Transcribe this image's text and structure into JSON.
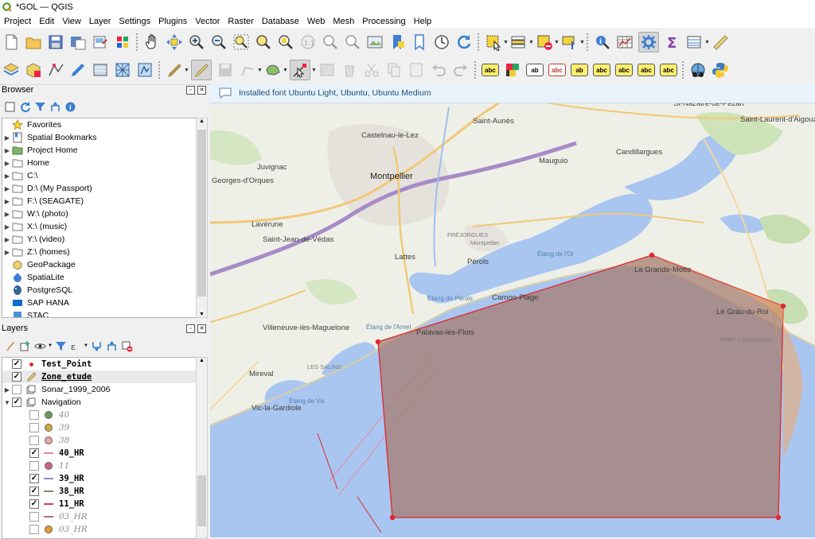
{
  "window": {
    "title": "*GOL — QGIS"
  },
  "menu": [
    "Project",
    "Edit",
    "View",
    "Layer",
    "Settings",
    "Plugins",
    "Vector",
    "Raster",
    "Database",
    "Web",
    "Mesh",
    "Processing",
    "Help"
  ],
  "colors": {
    "accent": "#0a64ad",
    "polygon_stroke": "#e0282e",
    "polygon_fill": "#a5786c",
    "message_bg": "#e9f3fb"
  },
  "browser": {
    "title": "Browser",
    "items": [
      {
        "label": "Favorites",
        "icon": "star-icon",
        "expandable": false
      },
      {
        "label": "Spatial Bookmarks",
        "icon": "bookmark-icon",
        "expandable": true
      },
      {
        "label": "Project Home",
        "icon": "folder-green-icon",
        "expandable": true
      },
      {
        "label": "Home",
        "icon": "folder-icon",
        "expandable": true
      },
      {
        "label": "C:\\",
        "icon": "folder-icon",
        "expandable": true
      },
      {
        "label": "D:\\ (My Passport)",
        "icon": "folder-icon",
        "expandable": true
      },
      {
        "label": "F:\\ (SEAGATE)",
        "icon": "folder-icon",
        "expandable": true
      },
      {
        "label": "W:\\ (photo)",
        "icon": "folder-icon",
        "expandable": true
      },
      {
        "label": "X:\\ (music)",
        "icon": "folder-icon",
        "expandable": true
      },
      {
        "label": "Y:\\ (video)",
        "icon": "folder-icon",
        "expandable": true
      },
      {
        "label": "Z:\\ (homes)",
        "icon": "folder-icon",
        "expandable": true
      },
      {
        "label": "GeoPackage",
        "icon": "geopackage-icon",
        "expandable": false
      },
      {
        "label": "SpatiaLite",
        "icon": "spatialite-icon",
        "expandable": false
      },
      {
        "label": "PostgreSQL",
        "icon": "postgresql-icon",
        "expandable": false
      },
      {
        "label": "SAP HANA",
        "icon": "sap-hana-icon",
        "expandable": false
      },
      {
        "label": "STAC",
        "icon": "stac-icon",
        "expandable": false
      }
    ]
  },
  "layers": {
    "title": "Layers",
    "items": [
      {
        "label": "Test_Point",
        "checked": true,
        "style": "bold",
        "symbol": "red-dot",
        "indent": 0,
        "expand": ""
      },
      {
        "label": "Zone_etude",
        "checked": true,
        "style": "bold under",
        "symbol": "pencil",
        "indent": 0,
        "expand": "",
        "selected": true
      },
      {
        "label": "Sonar_1999_2006",
        "checked": false,
        "style": "normal",
        "symbol": "group",
        "indent": 0,
        "expand": "▶"
      },
      {
        "label": "Navigation",
        "checked": true,
        "style": "normal",
        "symbol": "group",
        "indent": 0,
        "expand": "▼"
      },
      {
        "label": "40",
        "checked": false,
        "style": "italic",
        "symbol": "dot:#6a9a55",
        "indent": 1,
        "expand": ""
      },
      {
        "label": "39",
        "checked": false,
        "style": "italic",
        "symbol": "dot:#d2a542",
        "indent": 1,
        "expand": ""
      },
      {
        "label": "38",
        "checked": false,
        "style": "italic",
        "symbol": "dot:#e7a7a0",
        "indent": 1,
        "expand": ""
      },
      {
        "label": "40_HR",
        "checked": true,
        "style": "bold",
        "symbol": "line:#e78b90",
        "indent": 1,
        "expand": ""
      },
      {
        "label": "11",
        "checked": false,
        "style": "italic",
        "symbol": "dot:#c7687a",
        "indent": 1,
        "expand": ""
      },
      {
        "label": "39_HR",
        "checked": true,
        "style": "bold",
        "symbol": "line:#8c8fc7",
        "indent": 1,
        "expand": ""
      },
      {
        "label": "38_HR",
        "checked": true,
        "style": "bold",
        "symbol": "line:#7c8f60",
        "indent": 1,
        "expand": ""
      },
      {
        "label": "11_HR",
        "checked": true,
        "style": "bold",
        "symbol": "line:#d0443f",
        "indent": 1,
        "expand": ""
      },
      {
        "label": "03_HR",
        "checked": false,
        "style": "italic",
        "symbol": "line:#b07080",
        "indent": 1,
        "expand": ""
      },
      {
        "label": "03_HR",
        "checked": false,
        "style": "italic",
        "symbol": "dot:#e59b2a",
        "indent": 1,
        "expand": ""
      }
    ]
  },
  "map": {
    "message": "Installed font Ubuntu Light, Ubuntu, Ubuntu Medium",
    "labels": {
      "montpellier": "Montpellier",
      "castelnau": "Castelnau-le-Lez",
      "mauguio": "Mauguio",
      "saint_aunes": "Saint-Aunès",
      "candillargues": "Candillargues",
      "st_nazaire": "St-Nazaire-de-Pézan",
      "st_laurent": "Saint-Laurent-d'Aigouze",
      "juvignac": "Juvignac",
      "georges": "Georges-d'Orques",
      "laverune": "Lavérune",
      "saint_jean": "Saint-Jean-de-Védas",
      "lattes": "Lattes",
      "perols": "Pérols",
      "villeneuve": "Villeneuve-lès-Maguelone",
      "carnon": "Carnon-Plage",
      "palavas": "Palavas-les-Flots",
      "grande_motte": "La Grande-Motte",
      "grau_du_roi": "Le Grau-du-Roi",
      "vic": "Vic-la-Gardiole",
      "mireval": "Mireval",
      "etang_or": "Étang de l'Or",
      "etang_perols": "Étang de Pérols",
      "etang_arnel": "Étang de l'Arnel",
      "etang_vic": "Étang de Vic",
      "frejorgues": "FRÉJORGUES",
      "montpellier_airport": "Montpellier",
      "sete_lido": "ÉTANG DE VIC",
      "port_camargue": "PORT CAMARGUE",
      "mireval_area": "LES SALINS"
    }
  }
}
